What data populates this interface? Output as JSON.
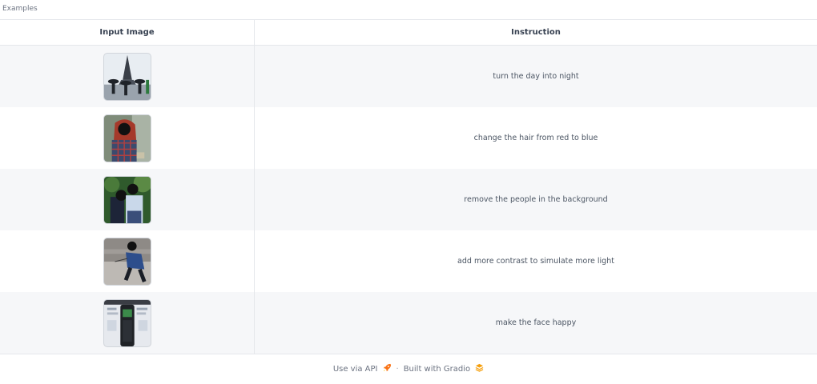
{
  "section_label": "Examples",
  "headers": {
    "input_image": "Input Image",
    "instruction": "Instruction"
  },
  "rows": [
    {
      "instruction": "turn the day into night",
      "thumb_icon": "eiffel-umbrellas-photo"
    },
    {
      "instruction": "change the hair from red to blue",
      "thumb_icon": "red-hair-woman-photo"
    },
    {
      "instruction": "remove the people in the background",
      "thumb_icon": "couple-photo"
    },
    {
      "instruction": "add more contrast to simulate more light",
      "thumb_icon": "runner-photo"
    },
    {
      "instruction": "make the face happy",
      "thumb_icon": "phone-photo"
    }
  ],
  "footer": {
    "api_label": "Use via API",
    "api_icon": "rocket-icon",
    "separator": "·",
    "built_label": "Built with Gradio",
    "gradio_icon": "gradio-logo-icon"
  },
  "colors": {
    "row_alt": "#f6f7f9",
    "border": "#e5e7eb",
    "text": "#4b5563"
  }
}
